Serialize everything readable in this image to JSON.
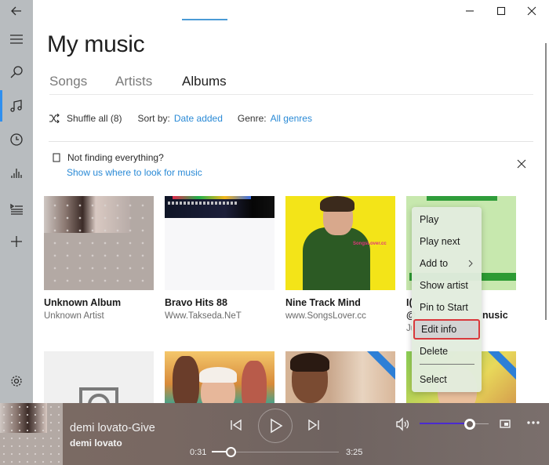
{
  "window": {
    "title": "My music",
    "controls": [
      "minimize",
      "maximize",
      "close"
    ]
  },
  "rail": {
    "items": [
      {
        "name": "back",
        "icon": "back-arrow-icon"
      },
      {
        "name": "menu",
        "icon": "hamburger-icon"
      },
      {
        "name": "search",
        "icon": "search-icon"
      },
      {
        "name": "my-music",
        "icon": "music-note-icon",
        "active": true
      },
      {
        "name": "recent-plays",
        "icon": "clock-icon"
      },
      {
        "name": "now-playing",
        "icon": "equalizer-icon"
      },
      {
        "name": "playlists",
        "icon": "playlist-icon"
      },
      {
        "name": "new-playlist",
        "icon": "plus-icon"
      },
      {
        "name": "settings",
        "icon": "gear-icon"
      }
    ],
    "accent_color": "#2f8fef"
  },
  "tabs": [
    {
      "label": "Songs",
      "active": false
    },
    {
      "label": "Artists",
      "active": false
    },
    {
      "label": "Albums",
      "active": true
    }
  ],
  "toolbar": {
    "shuffle_label": "Shuffle all (8)",
    "sort_label": "Sort by:",
    "sort_value": "Date added",
    "genre_label": "Genre:",
    "genre_value": "All genres"
  },
  "notice": {
    "title": "Not finding everything?",
    "link": "Show us where to look for music"
  },
  "albums": [
    {
      "title": "Unknown Album",
      "artist": "Unknown Artist"
    },
    {
      "title": "Bravo Hits 88",
      "artist": "Www.Takseda.NeT"
    },
    {
      "title": "Nine Track Mind",
      "artist": "www.SongsLover.cc"
    },
    {
      "title_start": "I(",
      "title_line2_start": "@",
      "title_line2_end": "nusic",
      "artist_start": "Ju"
    },
    {
      "title": "",
      "artist": ""
    },
    {
      "title": "",
      "artist": ""
    },
    {
      "title": "",
      "artist": ""
    },
    {
      "title": "",
      "artist": ""
    }
  ],
  "album_art_text": {
    "nine_track_tag": "SongsLover.cc"
  },
  "context_menu": {
    "items": [
      {
        "label": "Play"
      },
      {
        "label": "Play next"
      },
      {
        "label": "Add to",
        "submenu": true
      },
      {
        "label": "Show artist"
      },
      {
        "label": "Pin to Start"
      },
      {
        "label": "Edit info",
        "highlighted": true
      },
      {
        "label": "Delete"
      },
      {
        "label": "Select"
      }
    ],
    "highlight_color": "#d9383c"
  },
  "player": {
    "song_title": "demi lovato-Give",
    "artist": "demi lovato",
    "elapsed": "0:31",
    "duration": "3:25",
    "progress_fraction": 0.15,
    "volume_fraction": 0.73,
    "volume_color": "#4b2bd0"
  }
}
